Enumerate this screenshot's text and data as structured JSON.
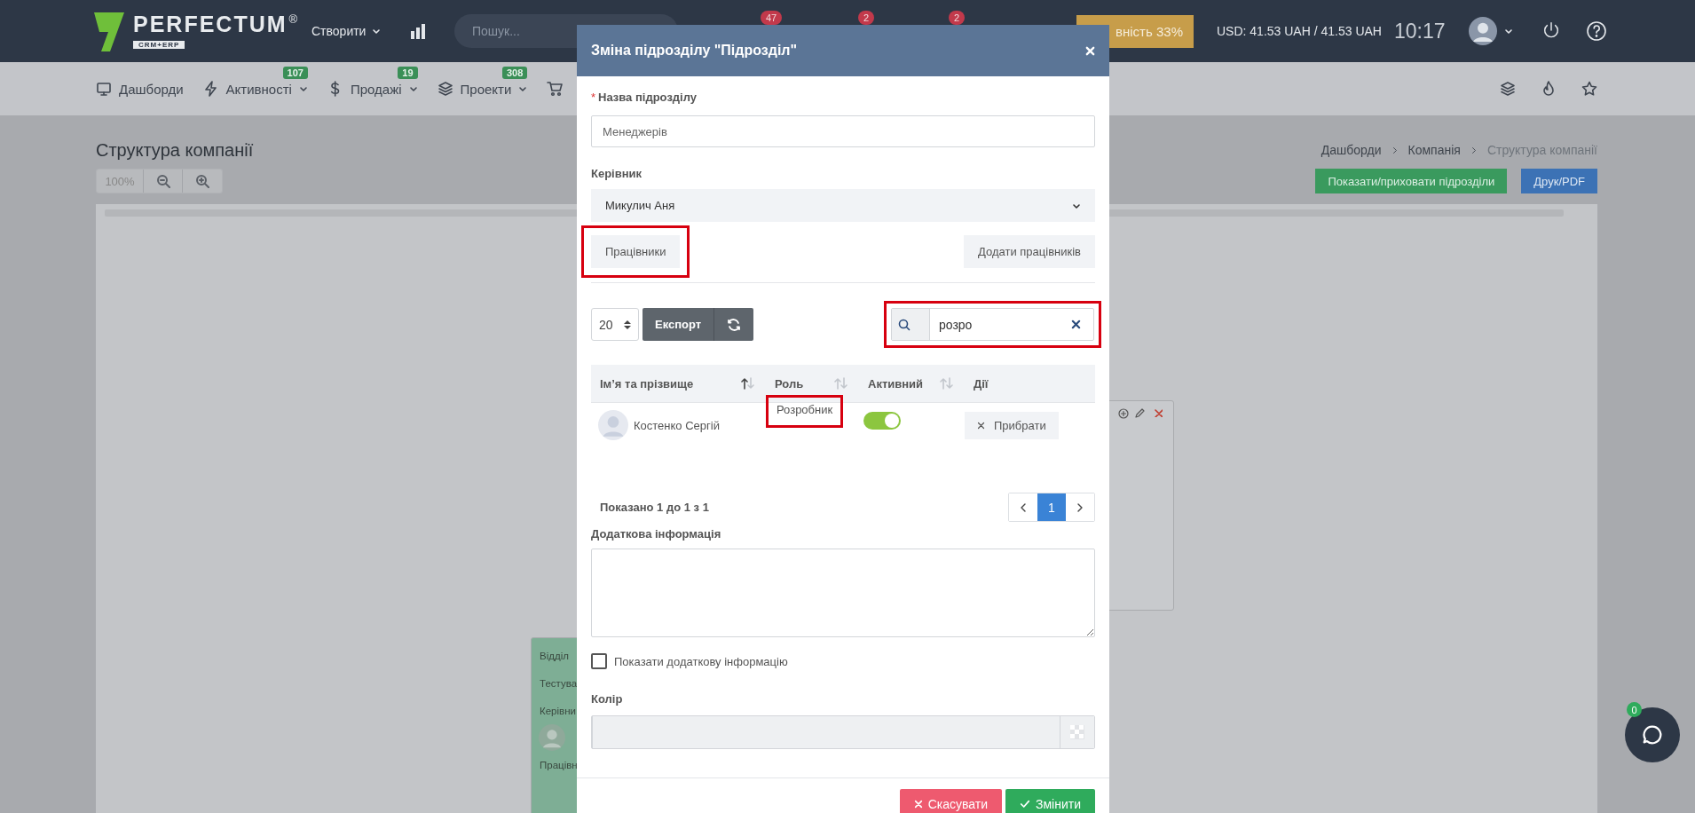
{
  "header": {
    "logo": "PERFECTUM",
    "logo_mark": "®",
    "logo_sub": "CRM+ERP",
    "create_menu": "Створити",
    "search": {
      "placeholder": "Пошук..."
    },
    "badges": [
      "47",
      "2",
      "2"
    ],
    "progress_button": "вність 33%",
    "currency": "USD: 41.53 UAH / 41.53 UAH",
    "time": "10:17"
  },
  "nav": {
    "items": [
      {
        "label": "Дашборди"
      },
      {
        "label": "Активності",
        "badge": "107"
      },
      {
        "label": "Продажі",
        "badge": "19"
      },
      {
        "label": "Проекти",
        "badge": "308"
      }
    ]
  },
  "page": {
    "title": "Структура компанії",
    "zoom": "100%",
    "breadcrumbs": [
      {
        "label": "Дашборди",
        "current": false
      },
      {
        "label": "Компанія",
        "current": false
      },
      {
        "label": "Структура компанії",
        "current": true
      }
    ],
    "buttons": [
      "Показати/приховати підрозділи",
      "Друк/PDF"
    ],
    "cards": [
      {
        "color": "#c8cacd"
      },
      {
        "color": "#7eae95",
        "texts": [
          "Відділ",
          "Тестува",
          "Керівни",
          "Працівн"
        ]
      }
    ]
  },
  "modal": {
    "title": "Зміна підрозділу \"Підрозділ\"",
    "required_mark": "*",
    "name_label": "Назва підрозділу",
    "name_value": "Менеджерів",
    "manager_label": "Керівник",
    "manager_value": "Микулич Аня",
    "tabs": [
      {
        "label": "Працівники",
        "highlighted": true
      },
      {
        "label": "Додати працівників",
        "highlighted": false
      }
    ],
    "page_size": "20",
    "export": "Експорт",
    "search": {
      "value": "розро",
      "highlighted": true
    },
    "columns": [
      {
        "label": "Ім’я та прізвище",
        "sorted": true
      },
      {
        "label": "Роль",
        "sorted": false
      },
      {
        "label": "Активний",
        "sorted": false
      },
      {
        "label": "Дії"
      }
    ],
    "rows": [
      {
        "name": "Костенко Сергій",
        "role": "Розробник",
        "role_highlighted": true,
        "active": true,
        "action": "Прибрати"
      }
    ],
    "info": "Показано 1 до 1 з 1",
    "pages": [
      {
        "label": "1",
        "selected": true
      }
    ],
    "extra_label": "Додаткова інформація",
    "show_extra": {
      "label": "Показати додаткову інформацію",
      "checked": false
    },
    "color_label": "Колір",
    "cancel": "Скасувати",
    "submit": "Змінити"
  },
  "chat": {
    "badge": "0"
  }
}
